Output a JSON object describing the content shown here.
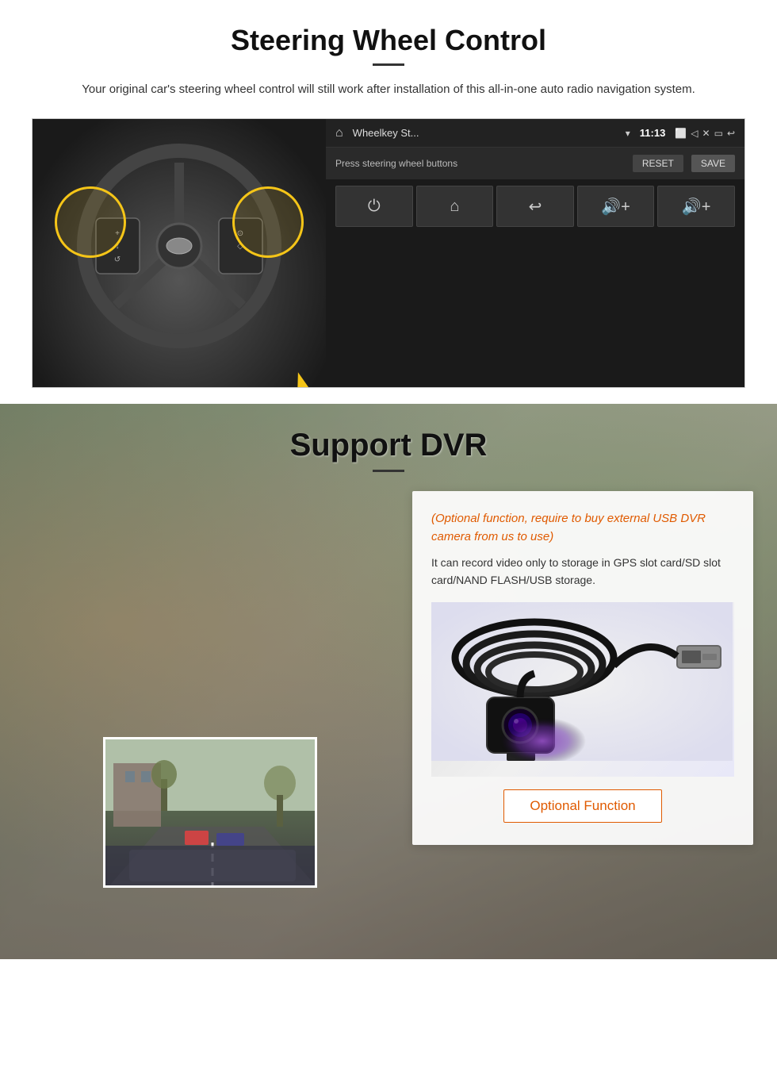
{
  "swc": {
    "title": "Steering Wheel Control",
    "subtitle": "Your original car's steering wheel control will still work after installation of this all-in-one auto radio navigation system.",
    "screen": {
      "app_name": "Wheelkey St... ",
      "time": "11:13",
      "bar_label": "Press steering wheel buttons",
      "reset_label": "RESET",
      "save_label": "SAVE",
      "buttons": [
        {
          "icon": "⏻",
          "label": "power"
        },
        {
          "icon": "⌂",
          "label": "home"
        },
        {
          "icon": "↩",
          "label": "back"
        },
        {
          "icon": "🔊+",
          "label": "vol-up-1"
        },
        {
          "icon": "🔊+",
          "label": "vol-up-2"
        }
      ]
    }
  },
  "dvr": {
    "title": "Support DVR",
    "optional_text": "(Optional function, require to buy external USB DVR camera from us to use)",
    "description": "It can record video only to storage in GPS slot card/SD slot card/NAND FLASH/USB storage.",
    "optional_button_label": "Optional Function"
  }
}
